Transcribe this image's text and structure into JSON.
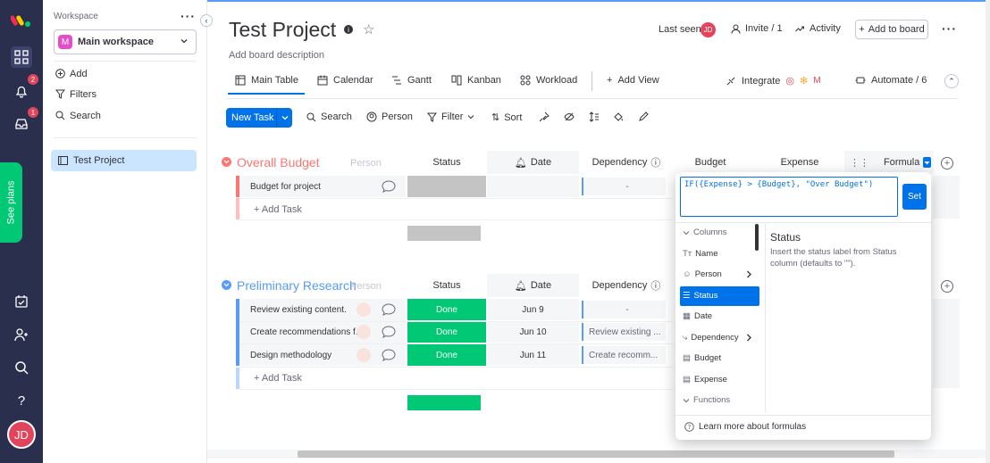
{
  "rail": {
    "badges": [
      "2",
      "1"
    ],
    "see_plans": "See plans",
    "avatar": "JD"
  },
  "workspace": {
    "label": "Workspace",
    "selected": "Main workspace",
    "logo_letter": "M",
    "actions": [
      "Add",
      "Filters",
      "Search"
    ],
    "boards": [
      "Test Project"
    ]
  },
  "board": {
    "title": "Test Project",
    "description": "Add board description",
    "last_seen": "Last seen",
    "last_seen_avatar": "JD",
    "invite": "Invite / 1",
    "activity": "Activity",
    "add_to_board": "Add to board"
  },
  "tabs": [
    "Main Table",
    "Calendar",
    "Gantt",
    "Kanban",
    "Workload",
    "Add View"
  ],
  "integrate": "Integrate",
  "automate": "Automate / 6",
  "toolbar": {
    "new_task": "New Task",
    "search": "Search",
    "person": "Person",
    "filter": "Filter",
    "sort": "Sort"
  },
  "columns": {
    "person": "Person",
    "status": "Status",
    "date": "Date",
    "dependency": "Dependency",
    "budget": "Budget",
    "expense": "Expense",
    "formula": "Formula"
  },
  "groups": [
    {
      "title": "Overall Budget",
      "color": "#ff7575",
      "rows": [
        {
          "name": "Budget for project",
          "status": "",
          "date": "",
          "dependency": "-"
        }
      ],
      "add": "+ Add Task"
    },
    {
      "title": "Preliminary Research",
      "color": "#579bfc",
      "rows": [
        {
          "name": "Review existing content.",
          "status": "Done",
          "date": "Jun 9",
          "dependency": "-"
        },
        {
          "name": "Create recommendations f...",
          "status": "Done",
          "date": "Jun 10",
          "dependency": "Review existing ..."
        },
        {
          "name": "Design methodology",
          "status": "Done",
          "date": "Jun 11",
          "dependency": "Create recomm..."
        }
      ],
      "add": "+ Add Task"
    }
  ],
  "formula": {
    "expression": "IF({Expense} > {Budget}, \"Over Budget\")",
    "set": "Set",
    "columns_header": "Columns",
    "items": [
      "Name",
      "Person",
      "Status",
      "Date",
      "Dependency",
      "Budget",
      "Expense"
    ],
    "functions_header": "Functions",
    "info_title": "Status",
    "info_text": "Insert the status label from Status column (defaults to \"\").",
    "learn_more": "Learn more about formulas"
  }
}
